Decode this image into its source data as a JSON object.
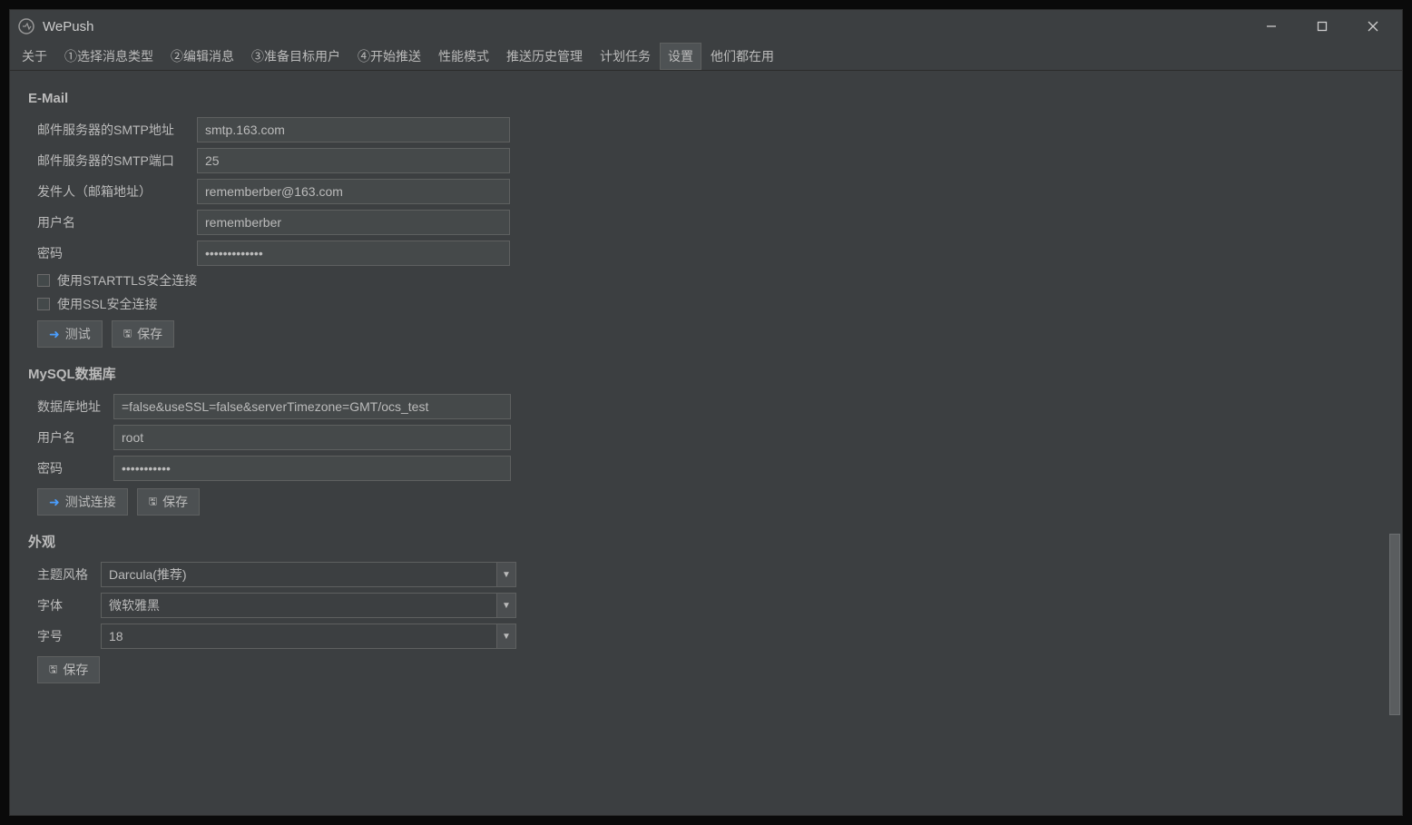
{
  "app": {
    "title": "WePush"
  },
  "tabs": [
    "关于",
    "①选择消息类型",
    "②编辑消息",
    "③准备目标用户",
    "④开始推送",
    "性能模式",
    "推送历史管理",
    "计划任务",
    "设置",
    "他们都在用"
  ],
  "activeTab": 8,
  "email": {
    "title": "E-Mail",
    "labels": {
      "smtp_addr": "邮件服务器的SMTP地址",
      "smtp_port": "邮件服务器的SMTP端口",
      "sender": "发件人（邮箱地址）",
      "username": "用户名",
      "password": "密码",
      "starttls": "使用STARTTLS安全连接",
      "ssl": "使用SSL安全连接"
    },
    "values": {
      "smtp_addr": "smtp.163.com",
      "smtp_port": "25",
      "sender": "rememberber@163.com",
      "username": "rememberber",
      "password": "•••••••••••••"
    },
    "buttons": {
      "test": "测试",
      "save": "保存"
    }
  },
  "mysql": {
    "title": "MySQL数据库",
    "labels": {
      "db_addr": "数据库地址",
      "username": "用户名",
      "password": "密码"
    },
    "values": {
      "db_addr": "=false&useSSL=false&serverTimezone=GMT/ocs_test",
      "username": "root",
      "password": "•••••••••••"
    },
    "buttons": {
      "test": "测试连接",
      "save": "保存"
    }
  },
  "appearance": {
    "title": "外观",
    "labels": {
      "theme": "主题风格",
      "font": "字体",
      "fontsize": "字号"
    },
    "values": {
      "theme": "Darcula(推荐)",
      "font": "微软雅黑",
      "fontsize": "18"
    },
    "buttons": {
      "save": "保存"
    }
  }
}
